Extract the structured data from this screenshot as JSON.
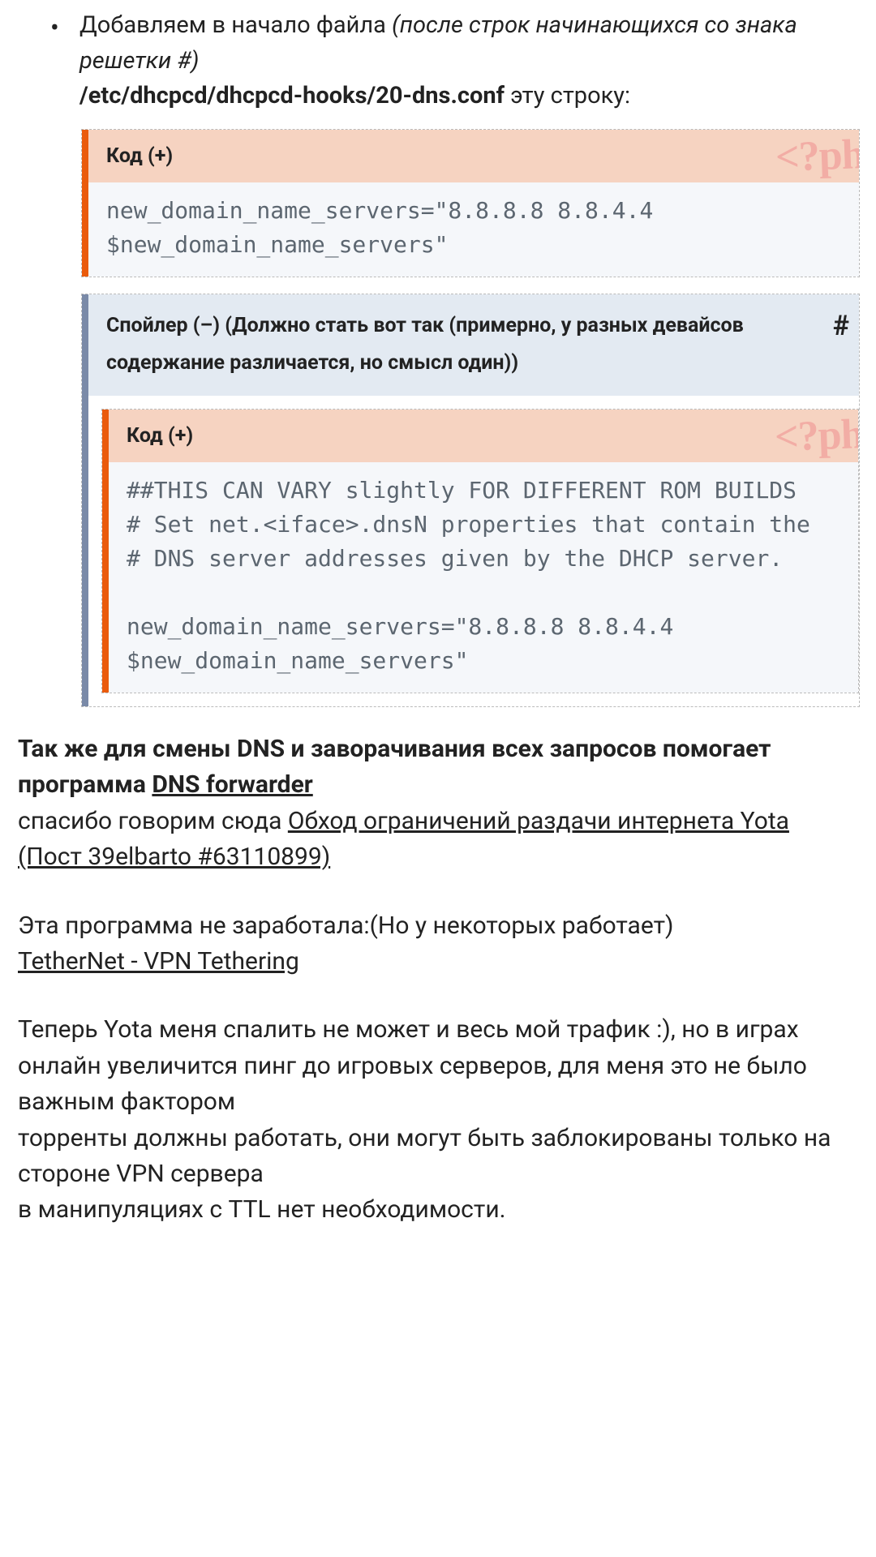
{
  "bullet": {
    "prefix": "Добавляем в начало файла ",
    "italic": "(после строк начинающихся со знака решетки #)",
    "path": "/etc/dhcpcd/dhcpcd-hooks/20-dns.conf",
    "suffix": " эту строку:"
  },
  "code1": {
    "header": "Код (+)",
    "watermark": "<?ph",
    "body": "new_domain_name_servers=\"8.8.8.8 8.8.4.4 $new_domain_name_servers\""
  },
  "spoiler": {
    "header": "Спойлер (–) (Должно стать вот так (примерно, у разных девайсов содержание различается, но смысл один))",
    "hash": "#",
    "code": {
      "header": "Код (+)",
      "watermark": "<?ph",
      "body": "##THIS CAN VARY slightly FOR DIFFERENT ROM BUILDS\n# Set net.<iface>.dnsN properties that contain the\n# DNS server addresses given by the DHCP server.\n\nnew_domain_name_servers=\"8.8.8.8 8.8.4.4 $new_domain_name_servers\""
    }
  },
  "lower": {
    "p1_prefix": "Так же для смены DNS и заворачивания всех запросов помогает программа ",
    "p1_link": "DNS forwarder",
    "p2_prefix": "спасибо говорим сюда ",
    "p2_link": "Обход ограничений раздачи интернета Yota (Пост 39elbarto #63110899)",
    "p3": "Эта программа не заработала:(Но у некоторых работает)",
    "p3_link": "TetherNet - VPN Tethering",
    "p4": "Теперь Yota меня спалить не может и весь мой трафик :), но в играх онлайн увеличится пинг до игровых серверов, для меня это не было важным фактором",
    "p5": "торренты должны работать, они могут быть заблокированы только на стороне VPN сервера",
    "p6": "в манипуляциях с TTL нет необходимости."
  }
}
